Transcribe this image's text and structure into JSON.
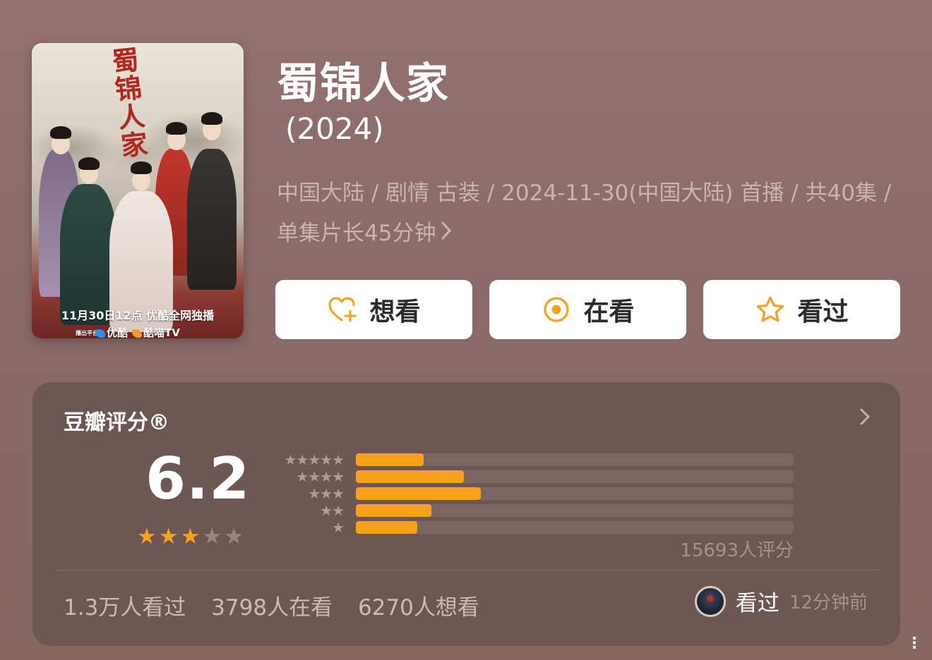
{
  "poster": {
    "calligraphy": "蜀锦人家",
    "caption": "11月30日12点 优酷全网独播",
    "platform_prefix": "播出平台",
    "platform_1": "优酷",
    "platform_2": "酷喵TV"
  },
  "header": {
    "title": "蜀锦人家",
    "year": "(2024)",
    "meta_line": "中国大陆 / 剧情 古装 / 2024-11-30(中国大陆) 首播 / 共40集 / 单集片长45分钟"
  },
  "actions": {
    "want": "想看",
    "watching": "在看",
    "watched": "看过"
  },
  "rating": {
    "title": "豆瓣评分®",
    "score": "6.2",
    "stars_filled": 3,
    "stars_total": 5,
    "distribution": [
      {
        "stars": 5,
        "fraction": 0.155
      },
      {
        "stars": 4,
        "fraction": 0.247
      },
      {
        "stars": 3,
        "fraction": 0.285
      },
      {
        "stars": 2,
        "fraction": 0.172
      },
      {
        "stars": 1,
        "fraction": 0.14
      }
    ],
    "count_text": "15693人评分"
  },
  "stats": {
    "watched": "1.3万人看过",
    "watching": "3798人在看",
    "want": "6270人想看"
  },
  "my_status": {
    "label": "看过",
    "time": "12分钟前"
  },
  "colors": {
    "accent": "#f7a21b",
    "background": "#8d6c6a",
    "card": "#6e5654"
  }
}
